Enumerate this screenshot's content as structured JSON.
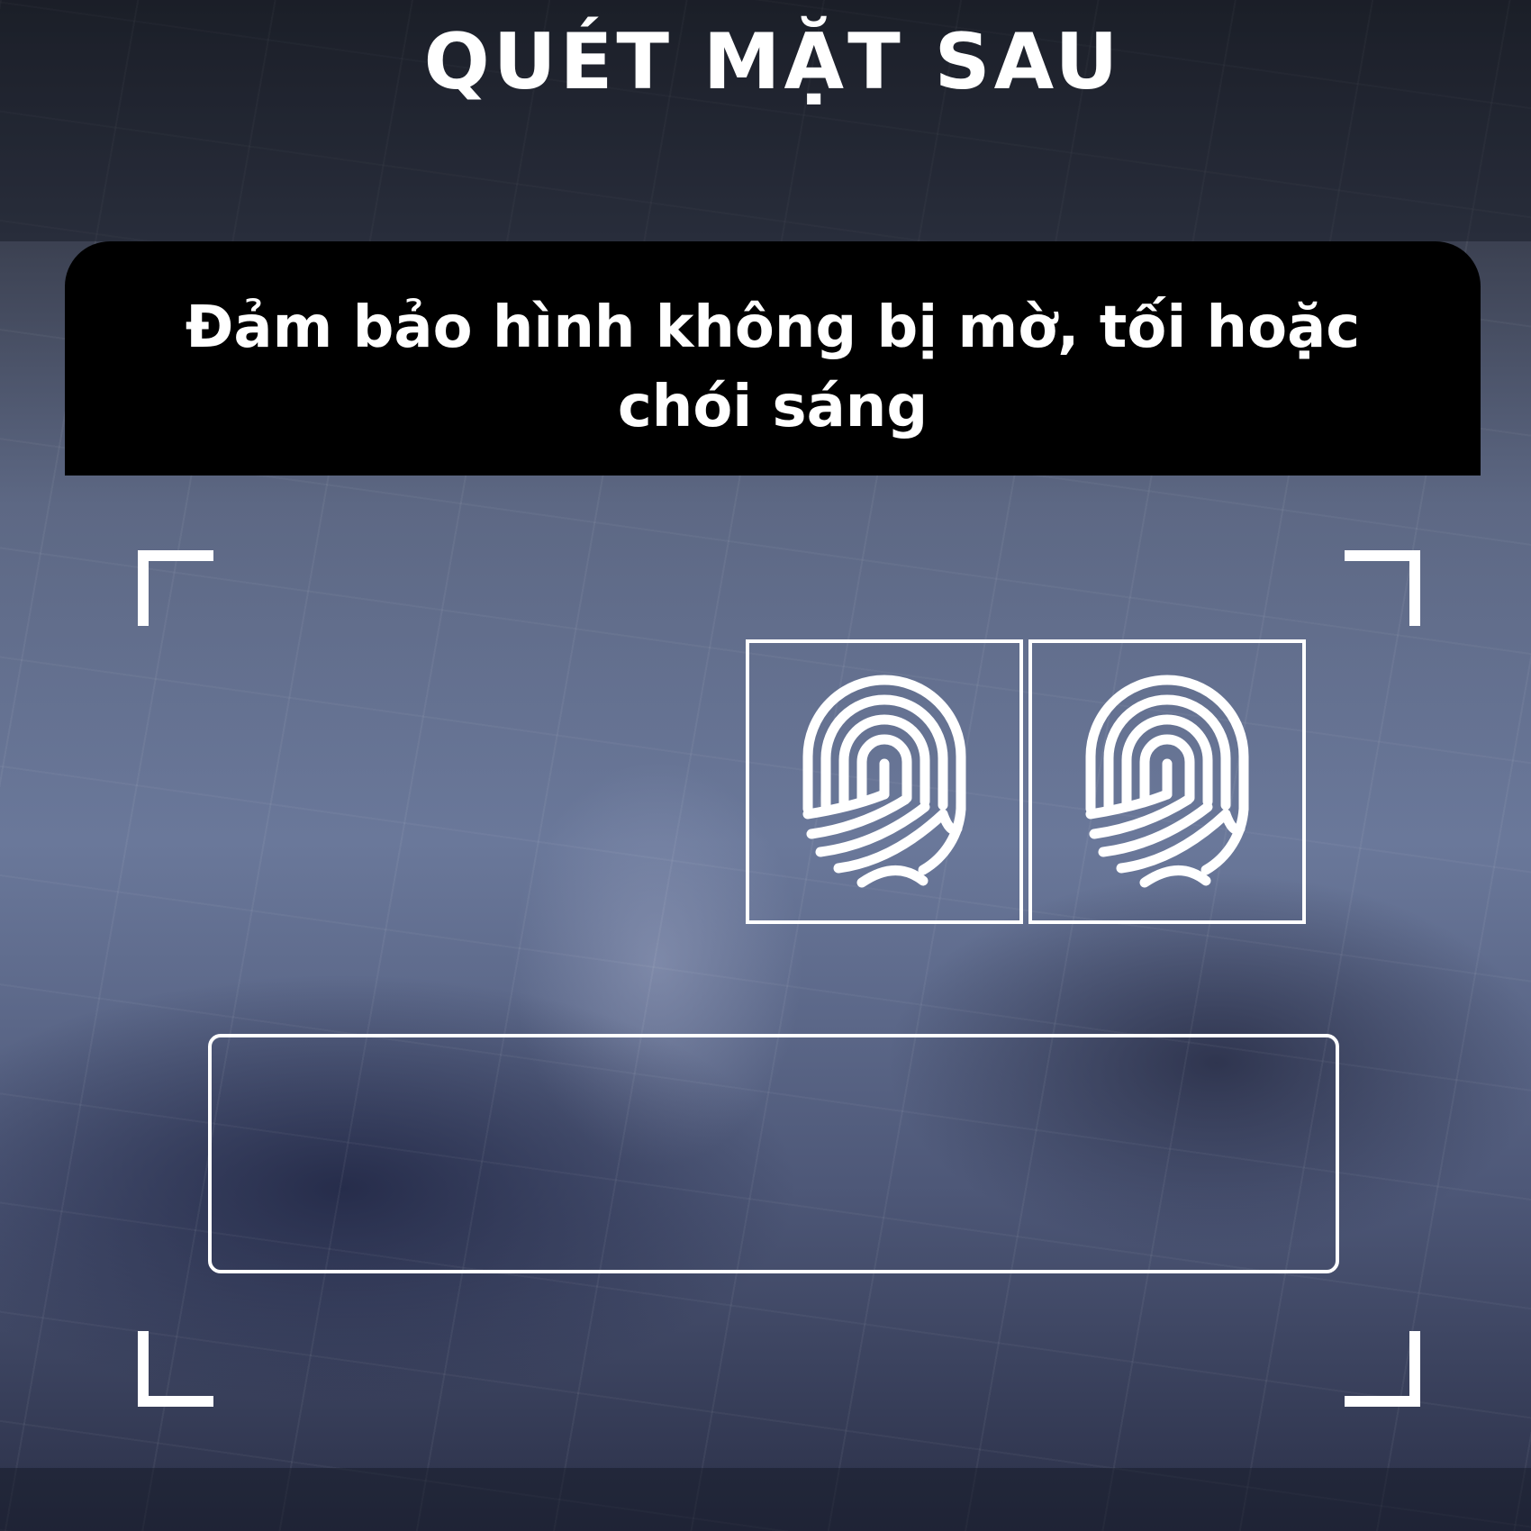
{
  "screen": {
    "title": "QUÉT MẶT SAU"
  },
  "scan_card": {
    "instruction": "Đảm bảo hình không bị mờ, tối hoặc chói sáng"
  },
  "icons": {
    "fingerprint": "fingerprint-icon"
  },
  "colors": {
    "instruction_bar": "#000000",
    "overlay_lines": "#ffffff"
  }
}
